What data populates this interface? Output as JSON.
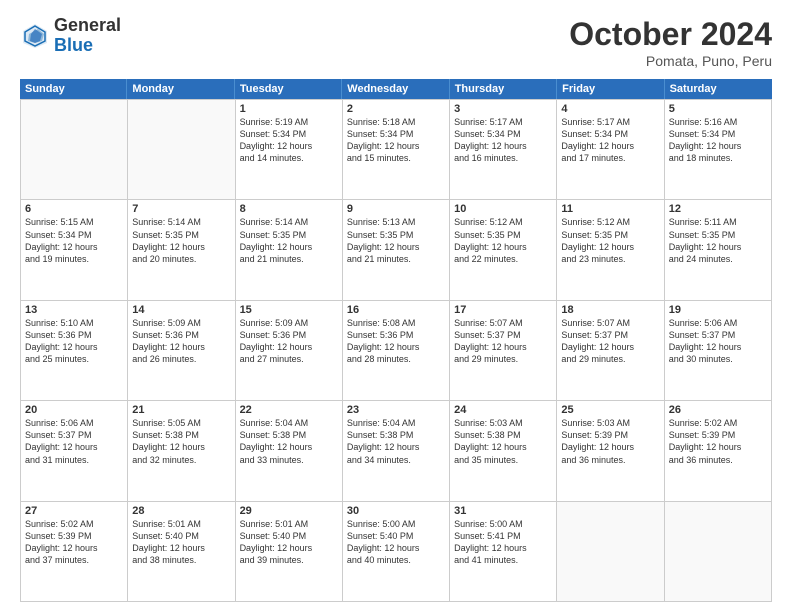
{
  "logo": {
    "general": "General",
    "blue": "Blue"
  },
  "header": {
    "month": "October 2024",
    "location": "Pomata, Puno, Peru"
  },
  "days_of_week": [
    "Sunday",
    "Monday",
    "Tuesday",
    "Wednesday",
    "Thursday",
    "Friday",
    "Saturday"
  ],
  "weeks": [
    [
      {
        "day": "",
        "info": ""
      },
      {
        "day": "",
        "info": ""
      },
      {
        "day": "1",
        "info": "Sunrise: 5:19 AM\nSunset: 5:34 PM\nDaylight: 12 hours\nand 14 minutes."
      },
      {
        "day": "2",
        "info": "Sunrise: 5:18 AM\nSunset: 5:34 PM\nDaylight: 12 hours\nand 15 minutes."
      },
      {
        "day": "3",
        "info": "Sunrise: 5:17 AM\nSunset: 5:34 PM\nDaylight: 12 hours\nand 16 minutes."
      },
      {
        "day": "4",
        "info": "Sunrise: 5:17 AM\nSunset: 5:34 PM\nDaylight: 12 hours\nand 17 minutes."
      },
      {
        "day": "5",
        "info": "Sunrise: 5:16 AM\nSunset: 5:34 PM\nDaylight: 12 hours\nand 18 minutes."
      }
    ],
    [
      {
        "day": "6",
        "info": "Sunrise: 5:15 AM\nSunset: 5:34 PM\nDaylight: 12 hours\nand 19 minutes."
      },
      {
        "day": "7",
        "info": "Sunrise: 5:14 AM\nSunset: 5:35 PM\nDaylight: 12 hours\nand 20 minutes."
      },
      {
        "day": "8",
        "info": "Sunrise: 5:14 AM\nSunset: 5:35 PM\nDaylight: 12 hours\nand 21 minutes."
      },
      {
        "day": "9",
        "info": "Sunrise: 5:13 AM\nSunset: 5:35 PM\nDaylight: 12 hours\nand 21 minutes."
      },
      {
        "day": "10",
        "info": "Sunrise: 5:12 AM\nSunset: 5:35 PM\nDaylight: 12 hours\nand 22 minutes."
      },
      {
        "day": "11",
        "info": "Sunrise: 5:12 AM\nSunset: 5:35 PM\nDaylight: 12 hours\nand 23 minutes."
      },
      {
        "day": "12",
        "info": "Sunrise: 5:11 AM\nSunset: 5:35 PM\nDaylight: 12 hours\nand 24 minutes."
      }
    ],
    [
      {
        "day": "13",
        "info": "Sunrise: 5:10 AM\nSunset: 5:36 PM\nDaylight: 12 hours\nand 25 minutes."
      },
      {
        "day": "14",
        "info": "Sunrise: 5:09 AM\nSunset: 5:36 PM\nDaylight: 12 hours\nand 26 minutes."
      },
      {
        "day": "15",
        "info": "Sunrise: 5:09 AM\nSunset: 5:36 PM\nDaylight: 12 hours\nand 27 minutes."
      },
      {
        "day": "16",
        "info": "Sunrise: 5:08 AM\nSunset: 5:36 PM\nDaylight: 12 hours\nand 28 minutes."
      },
      {
        "day": "17",
        "info": "Sunrise: 5:07 AM\nSunset: 5:37 PM\nDaylight: 12 hours\nand 29 minutes."
      },
      {
        "day": "18",
        "info": "Sunrise: 5:07 AM\nSunset: 5:37 PM\nDaylight: 12 hours\nand 29 minutes."
      },
      {
        "day": "19",
        "info": "Sunrise: 5:06 AM\nSunset: 5:37 PM\nDaylight: 12 hours\nand 30 minutes."
      }
    ],
    [
      {
        "day": "20",
        "info": "Sunrise: 5:06 AM\nSunset: 5:37 PM\nDaylight: 12 hours\nand 31 minutes."
      },
      {
        "day": "21",
        "info": "Sunrise: 5:05 AM\nSunset: 5:38 PM\nDaylight: 12 hours\nand 32 minutes."
      },
      {
        "day": "22",
        "info": "Sunrise: 5:04 AM\nSunset: 5:38 PM\nDaylight: 12 hours\nand 33 minutes."
      },
      {
        "day": "23",
        "info": "Sunrise: 5:04 AM\nSunset: 5:38 PM\nDaylight: 12 hours\nand 34 minutes."
      },
      {
        "day": "24",
        "info": "Sunrise: 5:03 AM\nSunset: 5:38 PM\nDaylight: 12 hours\nand 35 minutes."
      },
      {
        "day": "25",
        "info": "Sunrise: 5:03 AM\nSunset: 5:39 PM\nDaylight: 12 hours\nand 36 minutes."
      },
      {
        "day": "26",
        "info": "Sunrise: 5:02 AM\nSunset: 5:39 PM\nDaylight: 12 hours\nand 36 minutes."
      }
    ],
    [
      {
        "day": "27",
        "info": "Sunrise: 5:02 AM\nSunset: 5:39 PM\nDaylight: 12 hours\nand 37 minutes."
      },
      {
        "day": "28",
        "info": "Sunrise: 5:01 AM\nSunset: 5:40 PM\nDaylight: 12 hours\nand 38 minutes."
      },
      {
        "day": "29",
        "info": "Sunrise: 5:01 AM\nSunset: 5:40 PM\nDaylight: 12 hours\nand 39 minutes."
      },
      {
        "day": "30",
        "info": "Sunrise: 5:00 AM\nSunset: 5:40 PM\nDaylight: 12 hours\nand 40 minutes."
      },
      {
        "day": "31",
        "info": "Sunrise: 5:00 AM\nSunset: 5:41 PM\nDaylight: 12 hours\nand 41 minutes."
      },
      {
        "day": "",
        "info": ""
      },
      {
        "day": "",
        "info": ""
      }
    ]
  ]
}
